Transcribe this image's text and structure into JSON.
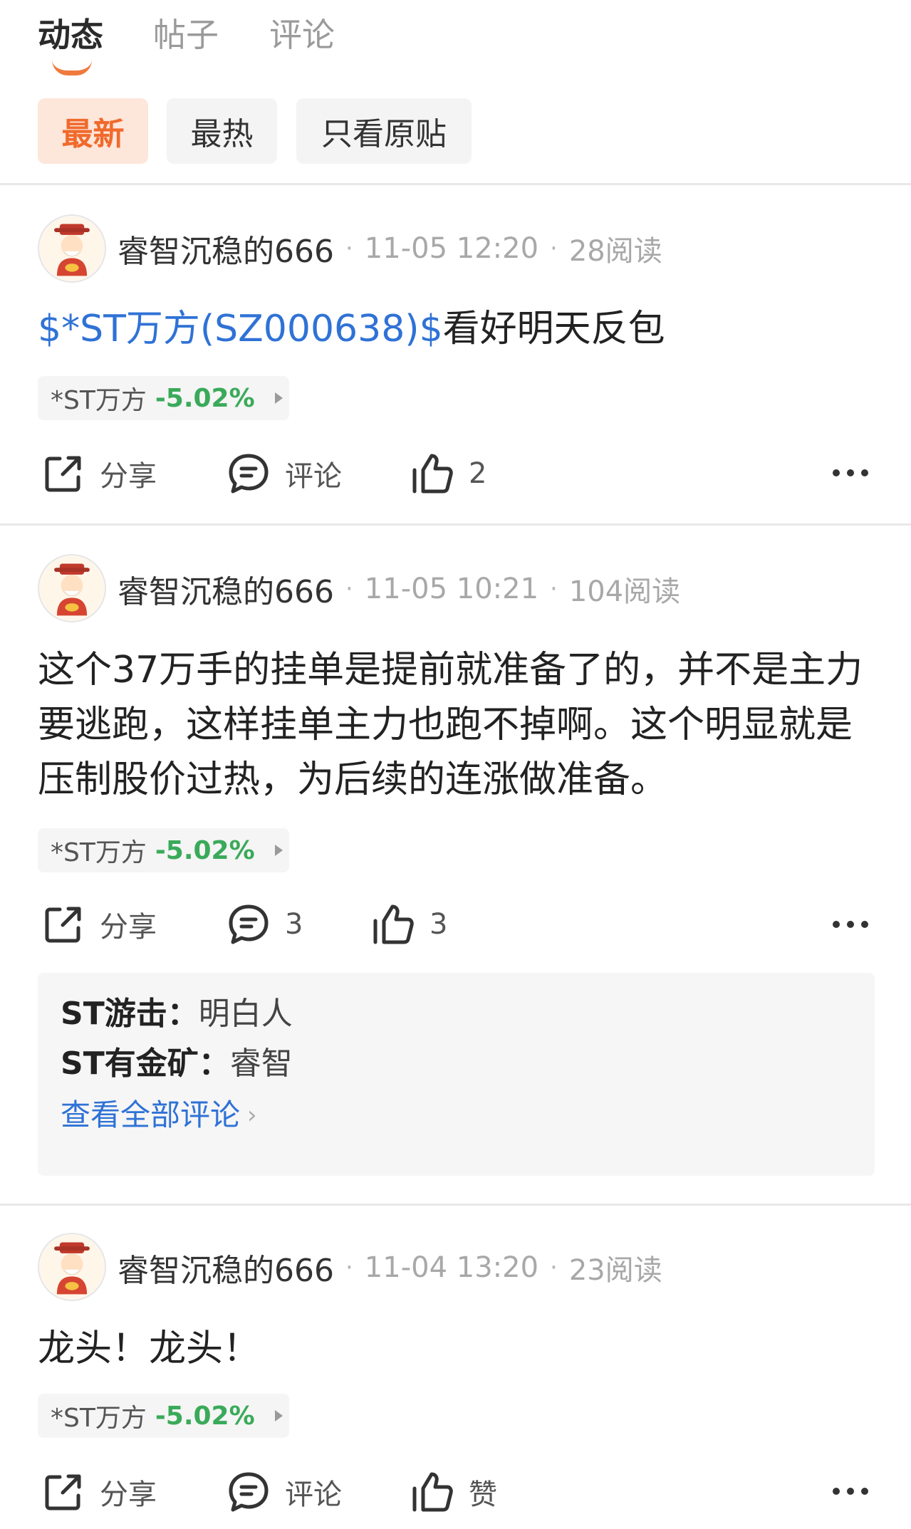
{
  "tabs": [
    {
      "label": "动态"
    },
    {
      "label": "帖子"
    },
    {
      "label": "评论"
    }
  ],
  "filters": [
    {
      "label": "最新"
    },
    {
      "label": "最热"
    },
    {
      "label": "只看原贴"
    }
  ],
  "posts": [
    {
      "author": "睿智沉稳的666",
      "time": "11-05 12:20",
      "reads": "28阅读",
      "content_cashtag": "$*ST万方(SZ000638)$",
      "content_text": "看好明天反包",
      "stock": {
        "name": "*ST万方",
        "change": "-5.02%"
      },
      "actions": {
        "share": "分享",
        "comment": "评论",
        "like": "2"
      }
    },
    {
      "author": "睿智沉稳的666",
      "time": "11-05 10:21",
      "reads": "104阅读",
      "content_text": "这个37万手的挂单是提前就准备了的，并不是主力要逃跑，这样挂单主力也跑不掉啊。这个明显就是压制股价过热，为后续的连涨做准备。",
      "stock": {
        "name": "*ST万方",
        "change": "-5.02%"
      },
      "actions": {
        "share": "分享",
        "comment": "3",
        "like": "3"
      },
      "comments": [
        {
          "user": "ST游击：",
          "text": "明白人"
        },
        {
          "user": "ST有金矿：",
          "text": "睿智"
        }
      ],
      "view_all": "查看全部评论"
    },
    {
      "author": "睿智沉稳的666",
      "time": "11-04 13:20",
      "reads": "23阅读",
      "content_text": "龙头！龙头！",
      "stock": {
        "name": "*ST万方",
        "change": "-5.02%"
      },
      "actions": {
        "share": "分享",
        "comment": "评论",
        "like": "赞"
      }
    }
  ],
  "separator": "·",
  "colors": {
    "accent": "#f06a2c",
    "link": "#2f72d6",
    "stock_change": "#3aaa5a"
  },
  "icons": [
    "avatar-caishen-icon",
    "share-icon",
    "comment-icon",
    "like-icon",
    "more-icon",
    "chevron-right-icon"
  ]
}
